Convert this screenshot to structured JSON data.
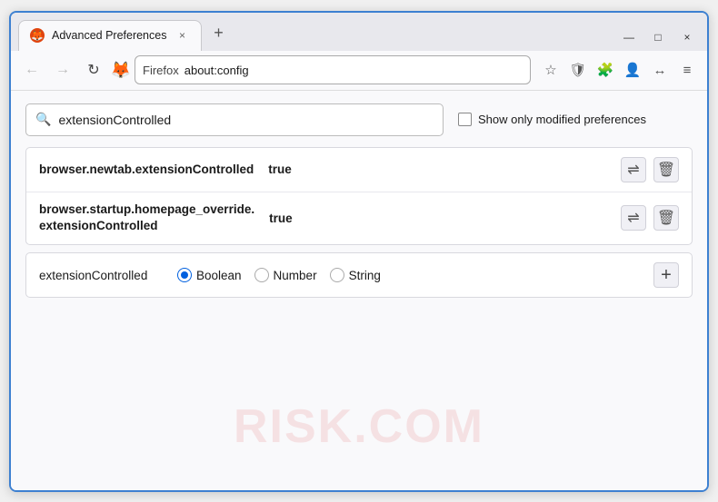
{
  "window": {
    "title": "Advanced Preferences",
    "tab_close": "×",
    "tab_new": "+",
    "win_minimize": "—",
    "win_restore": "□",
    "win_close": "×"
  },
  "navbar": {
    "back_icon": "←",
    "forward_icon": "→",
    "reload_icon": "↻",
    "browser_name": "Firefox",
    "address": "about:config",
    "bookmark_icon": "☆",
    "shield_icon": "🛡",
    "extension_icon": "🧩",
    "profile_icon": "👤",
    "history_icon": "↔",
    "menu_icon": "≡"
  },
  "search": {
    "placeholder": "extensionControlled",
    "value": "extensionControlled",
    "checkbox_label": "Show only modified preferences"
  },
  "results": [
    {
      "name": "browser.newtab.extensionControlled",
      "value": "true"
    },
    {
      "name_line1": "browser.startup.homepage_override.",
      "name_line2": "extensionControlled",
      "value": "true"
    }
  ],
  "add_pref": {
    "name": "extensionControlled",
    "radio_options": [
      {
        "label": "Boolean",
        "selected": true
      },
      {
        "label": "Number",
        "selected": false
      },
      {
        "label": "String",
        "selected": false
      }
    ],
    "add_label": "+"
  },
  "watermark": "RISK.COM",
  "icons": {
    "search": "🔍",
    "swap": "⇌",
    "delete": "🗑"
  }
}
